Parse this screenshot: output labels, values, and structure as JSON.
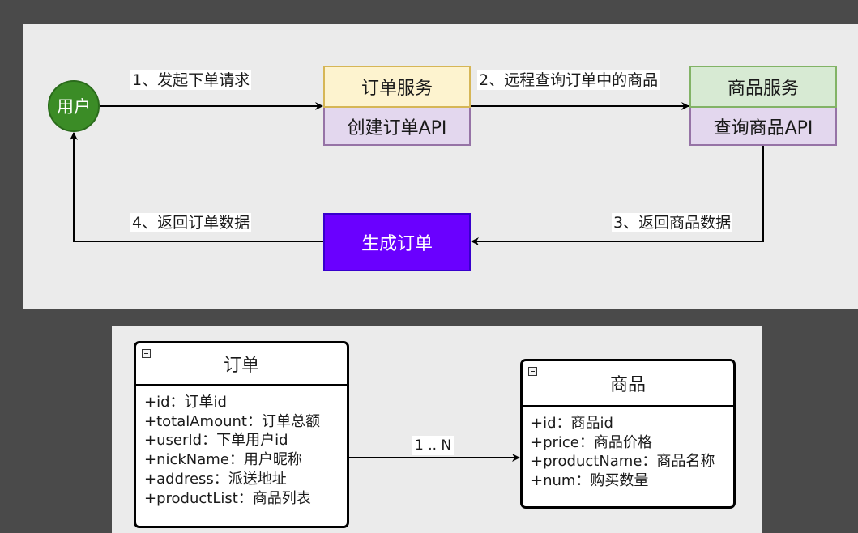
{
  "flow": {
    "user": "用户",
    "order_service": {
      "title": "订单服务",
      "api": "创建订单API"
    },
    "product_service": {
      "title": "商品服务",
      "api": "查询商品API"
    },
    "generate_order": "生成订单",
    "edges": {
      "step1": "1、发起下单请求",
      "step2": "2、远程查询订单中的商品",
      "step3": "3、返回商品数据",
      "step4": "4、返回订单数据"
    }
  },
  "class_diagram": {
    "order": {
      "title": "订单",
      "fields": [
        "+id：订单id",
        "+totalAmount：订单总额",
        "+userId：下单用户id",
        "+nickName：用户昵称",
        "+address：派送地址",
        "+productList：商品列表"
      ]
    },
    "product": {
      "title": "商品",
      "fields": [
        "+id：商品id",
        "+price：商品价格",
        "+productName：商品名称",
        "+num：购买数量"
      ]
    },
    "relation_label": "1 .. N"
  },
  "colors": {
    "user_fill": "#3b8c26",
    "order_service_fill": "#fdf3cf",
    "product_service_fill": "#d7ead3",
    "api_fill": "#e3d7ee",
    "generate_fill": "#6a00ff",
    "panel_bg": "#ebebeb",
    "backdrop": "#4a4a4a"
  }
}
